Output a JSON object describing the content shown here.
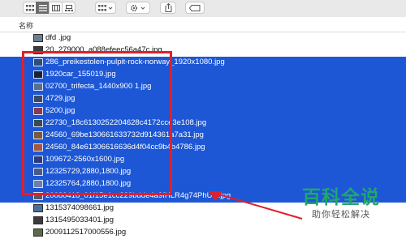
{
  "toolbar": {
    "icons": [
      "icon-view-grid",
      "list-view",
      "column-view",
      "gallery-view",
      "group-by",
      "action-gear",
      "share",
      "tag"
    ]
  },
  "header": {
    "name_column": "名称"
  },
  "files": [
    {
      "name": "dfd .jpg",
      "selected": false,
      "thumb": "#6a7f94"
    },
    {
      "name": "20_279000_a088efeec56a47c.jpg",
      "selected": false,
      "thumb": "#3c3c3c"
    },
    {
      "name": "286_preikestolen-pulpit-rock-norway_1920x1080.jpg",
      "selected": true,
      "thumb": "#2f4f78"
    },
    {
      "name": "1920car_155019.jpg",
      "selected": true,
      "thumb": "#1c2230"
    },
    {
      "name": "02700_trifecta_1440x900 1.jpg",
      "selected": true,
      "thumb": "#5a6f8a"
    },
    {
      "name": "4729.jpg",
      "selected": true,
      "thumb": "#3b4a63"
    },
    {
      "name": "5200.jpg",
      "selected": true,
      "thumb": "#8a3b4e"
    },
    {
      "name": "22730_18c6130252204628c4172cce3e108.jpg",
      "selected": true,
      "thumb": "#3a4b56"
    },
    {
      "name": "24560_69be130661633732d914361a7a31.jpg",
      "selected": true,
      "thumb": "#7a5a3a"
    },
    {
      "name": "24560_84e61306616636d4f04cc9b4b4786.jpg",
      "selected": true,
      "thumb": "#a8583a"
    },
    {
      "name": "109672-2560x1600.jpg",
      "selected": true,
      "thumb": "#2f3a7a"
    },
    {
      "name": "12325729,2880,1800.jpg",
      "selected": true,
      "thumb": "#4b5a88"
    },
    {
      "name": "12325764,2880,1800.jpg",
      "selected": true,
      "thumb": "#6b7faa"
    },
    {
      "name": "20080418_01f15e1cc229bdde4a9fHLR4g74PhUO.jpg",
      "selected": true,
      "thumb": "#5a5a5a"
    },
    {
      "name": "1315374098661.jpg",
      "selected": false,
      "thumb": "#4a6f9a"
    },
    {
      "name": "1315495033401.jpg",
      "selected": false,
      "thumb": "#3b3b3b"
    },
    {
      "name": "2009112517000556.jpg",
      "selected": false,
      "thumb": "#5b6b4a"
    }
  ],
  "watermark": {
    "title": "百科全说",
    "subtitle": "助你轻松解决"
  },
  "colors": {
    "selection": "#1d57d6",
    "highlight_box": "#e0202b",
    "watermark_green": "#20a66a"
  }
}
